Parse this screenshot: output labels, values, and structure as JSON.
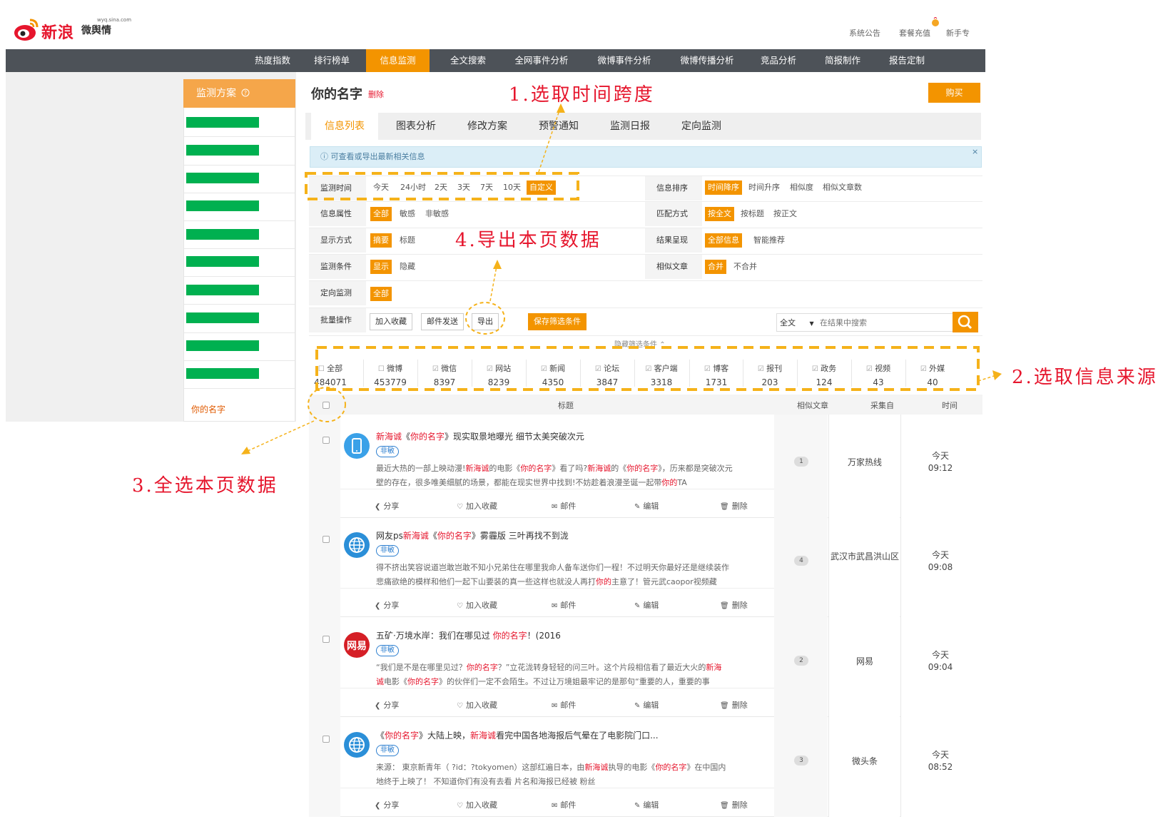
{
  "header": {
    "logo_text": "新浪",
    "logo_sub": "微舆情",
    "logo_url": "wyq.sina.com",
    "links": [
      "系统公告",
      "套餐充值",
      "新手专"
    ]
  },
  "nav": {
    "items": [
      "热度指数",
      "排行榜单",
      "信息监测",
      "全文搜索",
      "全网事件分析",
      "微博事件分析",
      "微博传播分析",
      "竞品分析",
      "简报制作",
      "报告定制"
    ],
    "active_index": 2
  },
  "sidebar": {
    "title": "监测方案",
    "help_icon": "help-circle-icon",
    "plan_name": "你的名字"
  },
  "main": {
    "title": "你的名字",
    "delete_label": "删除",
    "buy_label": "购买",
    "tabs": [
      "信息列表",
      "图表分析",
      "修改方案",
      "预警通知",
      "监测日报",
      "定向监测"
    ],
    "active_tab": 0,
    "info_text": "可查看或导出最新相关信息",
    "info_close": "×"
  },
  "filters": {
    "monitor_time": {
      "label": "监测时间",
      "options": [
        "今天",
        "24小时",
        "2天",
        "3天",
        "7天",
        "10天",
        "自定义"
      ],
      "selected": 6
    },
    "sort": {
      "label": "信息排序",
      "options": [
        "时间降序",
        "时间升序",
        "相似度",
        "相似文章数"
      ],
      "selected": 0
    },
    "attribute": {
      "label": "信息属性",
      "options": [
        "全部",
        "敏感",
        "非敏感"
      ],
      "selected": 0
    },
    "match": {
      "label": "匹配方式",
      "options": [
        "按全文",
        "按标题",
        "按正文"
      ],
      "selected": 0
    },
    "display": {
      "label": "显示方式",
      "options": [
        "摘要",
        "标题"
      ],
      "selected": 0
    },
    "result": {
      "label": "结果呈现",
      "options": [
        "全部信息",
        "智能推荐"
      ],
      "selected": 0
    },
    "condition": {
      "label": "监测条件",
      "options": [
        "显示",
        "隐藏"
      ],
      "selected": 0
    },
    "similar": {
      "label": "相似文章",
      "options": [
        "合并",
        "不合并"
      ],
      "selected": 0
    },
    "directed": {
      "label": "定向监测",
      "options": [
        "全部"
      ],
      "selected": 0
    },
    "batch": {
      "label": "批量操作",
      "buttons": [
        "加入收藏",
        "邮件发送",
        "导出"
      ],
      "save_label": "保存筛选条件"
    },
    "search": {
      "scope": "全文",
      "placeholder": "在结果中搜索"
    },
    "hide_conditions": "隐藏筛选条件"
  },
  "sources": [
    {
      "name": "全部",
      "count": "484071",
      "checked": false
    },
    {
      "name": "微博",
      "count": "453779",
      "checked": false
    },
    {
      "name": "微信",
      "count": "8397",
      "checked": true
    },
    {
      "name": "网站",
      "count": "8239",
      "checked": true
    },
    {
      "name": "新闻",
      "count": "4350",
      "checked": true
    },
    {
      "name": "论坛",
      "count": "3847",
      "checked": true
    },
    {
      "name": "客户端",
      "count": "3318",
      "checked": true
    },
    {
      "name": "博客",
      "count": "1731",
      "checked": true
    },
    {
      "name": "报刊",
      "count": "203",
      "checked": true
    },
    {
      "name": "政务",
      "count": "124",
      "checked": true
    },
    {
      "name": "视频",
      "count": "43",
      "checked": true
    },
    {
      "name": "外媒",
      "count": "40",
      "checked": true
    }
  ],
  "table": {
    "headers": [
      "标题",
      "相似文章",
      "采集自",
      "时间"
    ],
    "actions": [
      "分享",
      "加入收藏",
      "邮件",
      "编辑",
      "删除"
    ],
    "rows": [
      {
        "title_parts": [
          [
            "新海诚",
            true
          ],
          [
            "《",
            false
          ],
          [
            "你的名字",
            true
          ],
          [
            "》现实取景地曝光 细节太美突破次元",
            false
          ]
        ],
        "tag": "非敏",
        "summary1": [
          [
            "最近大热的一部上映动漫!",
            false
          ],
          [
            "新海诚",
            true
          ],
          [
            "的电影《",
            false
          ],
          [
            "你的名字",
            true
          ],
          [
            "》看了吗?",
            false
          ],
          [
            "新海诚",
            true
          ],
          [
            "的《",
            false
          ],
          [
            "你的名字",
            true
          ],
          [
            "》，历来都是突破次元",
            false
          ]
        ],
        "summary2": [
          [
            "壁的存在，很多唯美细腻的场景，都能在现实世界中找到!不妨趁着浪漫圣诞一起带",
            false
          ],
          [
            "你的",
            true
          ],
          [
            "TA",
            false
          ]
        ],
        "similar": "1",
        "source": "万家热线",
        "time_day": "今天",
        "time": "09:12",
        "avatar": "phone"
      },
      {
        "title_parts": [
          [
            "网友ps",
            false
          ],
          [
            "新海诚",
            true
          ],
          [
            "《",
            false
          ],
          [
            "你的名字",
            true
          ],
          [
            "》雾霾版 三叶再找不到泷",
            false
          ]
        ],
        "tag": "非敏",
        "summary1": [
          [
            "得不挤出笑容说道岂敢岂敢不知小兄弟住在哪里我命人备车送你们一程！不过明天你最好还是继续装作",
            false
          ]
        ],
        "summary2": [
          [
            "悲痛欲绝的模样和他们一起下山要装的真一些这样也就没人再打",
            false
          ],
          [
            "你的",
            true
          ],
          [
            "主意了！管元武caopor视频藏",
            false
          ]
        ],
        "similar": "4",
        "source": "武汉市武昌洪山区",
        "time_day": "今天",
        "time": "09:08",
        "avatar": "globe"
      },
      {
        "title_parts": [
          [
            "五矿·万境水岸：我们在哪见过 ",
            false
          ],
          [
            "你的名字",
            true
          ],
          [
            "！(2016",
            false
          ]
        ],
        "tag": "非敏",
        "summary1": [
          [
            "“我们是不是在哪里见过？",
            false
          ],
          [
            "你的名字",
            true
          ],
          [
            "？”立花泷转身轻轻的问三叶。这个片段相信看了最近大火的",
            false
          ],
          [
            "新海",
            true
          ]
        ],
        "summary2": [
          [
            "诚",
            true
          ],
          [
            "电影《",
            false
          ],
          [
            "你的名字",
            true
          ],
          [
            "》的伙伴们一定不会陌生。不过让万境姐最牢记的是那句“重要的人，重要的事",
            false
          ]
        ],
        "similar": "2",
        "source": "网易",
        "time_day": "今天",
        "time": "09:04",
        "avatar": "netease"
      },
      {
        "title_parts": [
          [
            "《",
            false
          ],
          [
            "你的名字",
            true
          ],
          [
            "》大陆上映，",
            false
          ],
          [
            "新海诚",
            true
          ],
          [
            "看完中国各地海报后气晕在了电影院门口...",
            false
          ]
        ],
        "tag": "非敏",
        "summary1": [
          [
            "来源： 東京新青年（ ?id：?tokyomen）这部红遍日本，由",
            false
          ],
          [
            "新海诚",
            true
          ],
          [
            "执导的电影《",
            false
          ],
          [
            "你的名字",
            true
          ],
          [
            "》在中国内",
            false
          ]
        ],
        "summary2": [
          [
            "地终于上映了！ 不知道你们有没有去看 片名和海报已经被 粉丝",
            false
          ]
        ],
        "similar": "3",
        "source": "微头条",
        "time_day": "今天",
        "time": "08:52",
        "avatar": "globe"
      }
    ]
  },
  "annotations": {
    "n1": "1.选取时间跨度",
    "n2": "2.选取信息来源",
    "n3": "3.全选本页数据",
    "n4": "4.导出本页数据",
    "color": "#e6162d",
    "dash_color": "#f5b21a"
  },
  "colors": {
    "accent": "#f39400",
    "nav_bg": "#4d5258",
    "sensitive_tag": "#2d7fd0",
    "green": "#00b050"
  }
}
